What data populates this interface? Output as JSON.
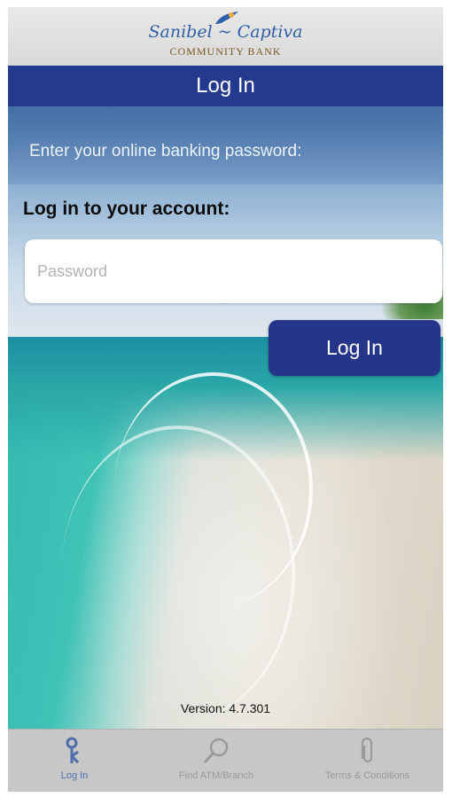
{
  "brand": {
    "logo_script": "Sanibel ~ Captiva",
    "logo_sub": "COMMUNITY BANK"
  },
  "header": {
    "title": "Log In"
  },
  "login": {
    "prompt": "Enter your online banking password:",
    "account_label": "Log in to your account:",
    "password_placeholder": "Password",
    "password_value": "",
    "button_label": "Log In"
  },
  "footer": {
    "version": "Version: 4.7.301"
  },
  "tabs": [
    {
      "label": "Log In",
      "icon": "key-icon",
      "active": true
    },
    {
      "label": "Find ATM/Branch",
      "icon": "search-icon",
      "active": false
    },
    {
      "label": "Terms & Conditions",
      "icon": "paperclip-icon",
      "active": false
    }
  ],
  "colors": {
    "title_bar": "#243a8e",
    "login_button": "#25368a",
    "active_tab": "#4d6fae",
    "inactive_tab": "#9a9a9a"
  }
}
